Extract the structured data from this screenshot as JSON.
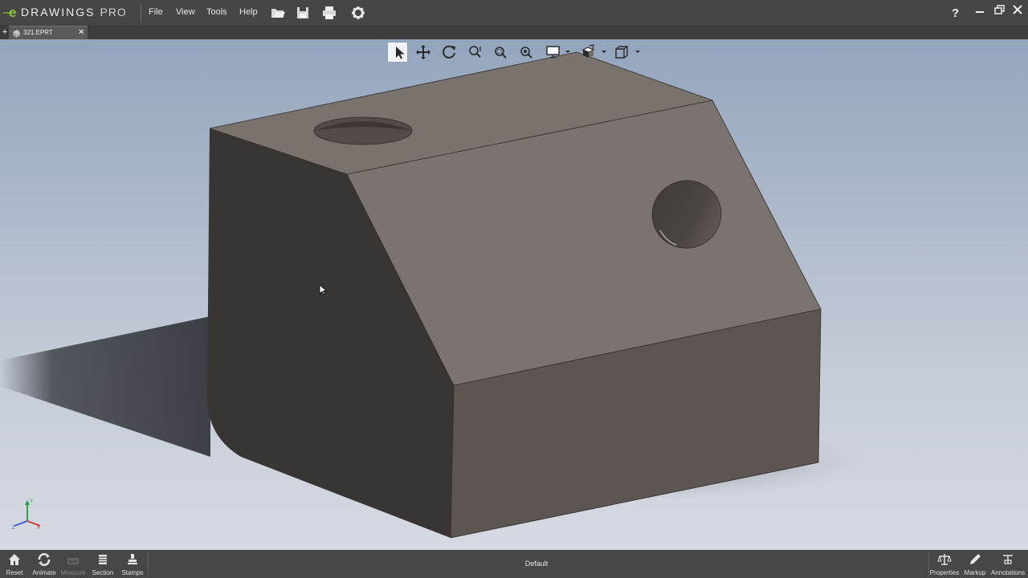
{
  "app": {
    "brand": "DRAWINGS",
    "brand_suffix": "PRO",
    "accent": "#8dc63f"
  },
  "menu": {
    "file": "File",
    "view": "View",
    "tools": "Tools",
    "help": "Help"
  },
  "toolbar_icons": [
    "open-folder-icon",
    "save-icon",
    "print-icon",
    "settings-gear-icon"
  ],
  "window_controls": [
    "help-icon",
    "minimize-icon",
    "restore-icon",
    "close-icon"
  ],
  "tabs": [
    {
      "label": "321.EPRT",
      "active": true
    }
  ],
  "hud_tools": [
    "select-arrow-icon",
    "pan-icon",
    "rotate-icon",
    "zoom-to-fit-icon",
    "zoom-to-area-icon",
    "zoom-in-out-icon",
    "display-style-icon",
    "view-orientation-icon",
    "standard-views-icon"
  ],
  "viewport": {
    "background_top": "#93a5bd",
    "background_bottom": "#d6dae2",
    "model_colors": {
      "top": "#7a726d",
      "front_upper": "#7b7370",
      "front_lower": "#5c5552",
      "side": "#383533"
    }
  },
  "bottom_bar": {
    "left_buttons": [
      {
        "label": "Reset",
        "icon": "home-icon",
        "enabled": true
      },
      {
        "label": "Animate",
        "icon": "animate-icon",
        "enabled": true
      },
      {
        "label": "Measure",
        "icon": "measure-icon",
        "enabled": false
      },
      {
        "label": "Section",
        "icon": "section-icon",
        "enabled": true
      },
      {
        "label": "Stamps",
        "icon": "stamps-icon",
        "enabled": true
      }
    ],
    "configuration": "Default",
    "right_buttons": [
      {
        "label": "Properties",
        "icon": "properties-icon",
        "enabled": true
      },
      {
        "label": "Markup",
        "icon": "markup-pen-icon",
        "enabled": true
      },
      {
        "label": "Annotations",
        "icon": "annotations-icon",
        "enabled": true
      }
    ]
  }
}
